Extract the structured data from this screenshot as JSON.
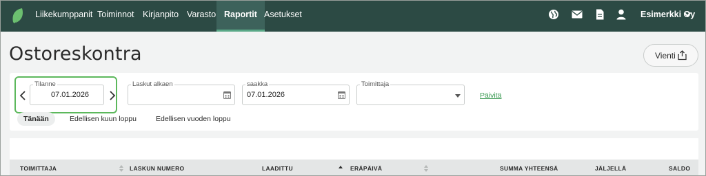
{
  "nav": {
    "items": [
      {
        "label": "Liikekumppanit"
      },
      {
        "label": "Toiminnot"
      },
      {
        "label": "Kirjanpito"
      },
      {
        "label": "Varasto"
      },
      {
        "label": "Raportit",
        "active": true
      },
      {
        "label": "Asetukset"
      }
    ],
    "company": "Esimerkki Oy",
    "icons": [
      "globe-icon",
      "mail-icon",
      "document-icon",
      "user-icon",
      "chevron-down-icon"
    ]
  },
  "page": {
    "title": "Ostoreskontra",
    "export_button": "Vienti"
  },
  "filters": {
    "tilanne": {
      "label": "Tilanne",
      "value": "07.01.2026"
    },
    "laskut_alkaen": {
      "label": "Laskut alkaen",
      "value": ""
    },
    "saakka": {
      "label": "saakka",
      "value": "07.01.2026"
    },
    "toimittaja": {
      "label": "Toimittaja",
      "value": ""
    },
    "refresh_link": "Päivitä",
    "quick_ranges": [
      {
        "label": "Tänään",
        "active": true
      },
      {
        "label": "Edellisen kuun loppu"
      },
      {
        "label": "Edellisen vuoden loppu"
      }
    ]
  },
  "table": {
    "columns": [
      {
        "label": "TOIMITTAJA"
      },
      {
        "label": "LASKUN NUMERO"
      },
      {
        "label": "LAADITTU",
        "sorted": "ascending"
      },
      {
        "label": "ERÄPÄIVÄ"
      },
      {
        "label": "SUMMA YHTEENSÄ"
      },
      {
        "label": "JÄLJELLÄ"
      },
      {
        "label": "SALDO"
      }
    ]
  },
  "colors": {
    "topbar": "#2c4a44",
    "active_tab": "#3d625b",
    "accent_green": "#5cb85c",
    "link_green": "#3a9a52"
  }
}
